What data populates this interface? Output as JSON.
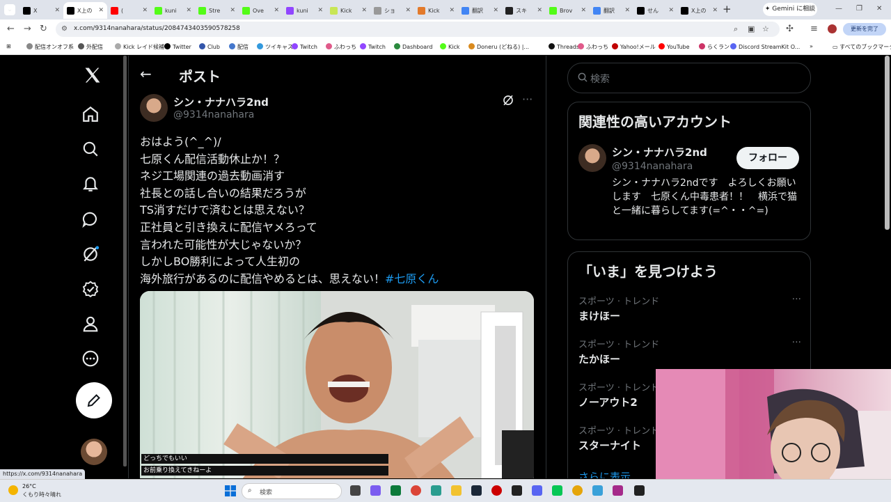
{
  "browser": {
    "tabs": [
      {
        "label": "X",
        "favicon": "x-icon",
        "color": "#000000"
      },
      {
        "label": "X上の",
        "favicon": "x-icon",
        "color": "#000000",
        "active": true
      },
      {
        "label": "(",
        "favicon": "youtube-icon",
        "color": "#ff0000"
      },
      {
        "label": "kuni",
        "favicon": "kick-icon",
        "color": "#53fc18"
      },
      {
        "label": "Stre",
        "favicon": "kick-icon",
        "color": "#53fc18"
      },
      {
        "label": "Ove",
        "favicon": "kick-icon",
        "color": "#53fc18"
      },
      {
        "label": "kuni",
        "favicon": "twitch-icon",
        "color": "#9146ff"
      },
      {
        "label": "Kick",
        "favicon": "kick-icon",
        "color": "#c8e655"
      },
      {
        "label": "ショ",
        "favicon": "shop-icon",
        "color": "#999999"
      },
      {
        "label": "Kick",
        "favicon": "wave-icon",
        "color": "#e37a2b"
      },
      {
        "label": "翻訳",
        "favicon": "google-icon",
        "color": "#4285f4"
      },
      {
        "label": "スキ",
        "favicon": "wiki-icon",
        "color": "#222222"
      },
      {
        "label": "Brov",
        "favicon": "kick-icon",
        "color": "#53fc18"
      },
      {
        "label": "翻訳",
        "favicon": "google-icon",
        "color": "#4285f4"
      },
      {
        "label": "せん",
        "favicon": "x-icon",
        "color": "#000000"
      },
      {
        "label": "X上の",
        "favicon": "x-icon",
        "color": "#000000"
      }
    ],
    "gemini_label": "Gemini に相談",
    "url": "x.com/9314nanahara/status/2084743403590578258",
    "update_label": "更新を完了",
    "bookmarks": [
      {
        "label": "配信オンオフ系",
        "color": "#888888"
      },
      {
        "label": "外配信",
        "color": "#555555"
      },
      {
        "label": "Kick レイド候補",
        "color": "#aaaaaa"
      },
      {
        "label": "Twitter",
        "color": "#000000"
      },
      {
        "label": "Club",
        "color": "#3355aa"
      },
      {
        "label": "配信",
        "color": "#4477cc"
      },
      {
        "label": "ツイキャス",
        "color": "#3399dd"
      },
      {
        "label": "Twitch",
        "color": "#9146ff"
      },
      {
        "label": "ふわっち",
        "color": "#e05a8a"
      },
      {
        "label": "Twitch",
        "color": "#9146ff"
      },
      {
        "label": "Dashboard",
        "color": "#2b8a3e"
      },
      {
        "label": "Kick",
        "color": "#53fc18"
      },
      {
        "label": "Doneru (どねる) |...",
        "color": "#d98a1e"
      },
      {
        "label": "Threads",
        "color": "#111111"
      },
      {
        "label": "ふわっち",
        "color": "#e05a8a"
      },
      {
        "label": "Yahoo!メール",
        "color": "#c00000"
      },
      {
        "label": "YouTube",
        "color": "#ff0000"
      },
      {
        "label": "らくラン",
        "color": "#cc3366"
      },
      {
        "label": "Discord StreamKit O...",
        "color": "#5865f2"
      }
    ],
    "all_bookmarks_label": "すべてのブックマーク",
    "status_url": "https://x.com/9314nanahara"
  },
  "post": {
    "title": "ポスト",
    "author_name": "シン・ナナハラ2nd",
    "author_handle": "@9314nanahara",
    "lines": [
      "おはよう(^_^)/",
      "七原くん配信活動休止か！？",
      "ネジ工場関連の過去動画消す",
      "社長との話し合いの結果だろうが",
      "TS消すだけで済むとは思えない？",
      "正社員と引き換えに配信ヤメろって",
      "言われた可能性が大じゃないか？",
      "しかしBO勝利によって人生初の"
    ],
    "last_line_text": "海外旅行があるのに配信やめるとは、思えない！",
    "hashtag": "#七原くん",
    "media_caption_1": "どっちでもいい",
    "media_caption_2": "お前乗り換えてきねーよ"
  },
  "sidebar": {
    "search_placeholder": "検索",
    "related_title": "関連性の高いアカウント",
    "related_name": "シン・ナナハラ2nd",
    "related_handle": "@9314nanahara",
    "follow_label": "フォロー",
    "related_bio": "シン・ナナハラ2ndです　よろしくお願いします　七原くん中毒患者！！　横浜で猫と一緒に暮らしてます(=^・・^=)",
    "trends_title": "「いま」を見つけよう",
    "trends": [
      {
        "category": "スポーツ · トレンド",
        "name": "まけほー"
      },
      {
        "category": "スポーツ · トレンド",
        "name": "たかほー"
      },
      {
        "category": "スポーツ · トレンド",
        "name": "ノーアウト2"
      },
      {
        "category": "スポーツ · トレンド",
        "name": "スターナイト"
      }
    ],
    "show_more": "さらに表示"
  },
  "taskbar": {
    "temperature": "26°C",
    "weather": "くもり時々晴れ",
    "search_label": "検索"
  },
  "colors": {
    "accent": "#1d9bf0",
    "background": "#000000",
    "border": "#2f3336",
    "muted": "#71767b"
  }
}
